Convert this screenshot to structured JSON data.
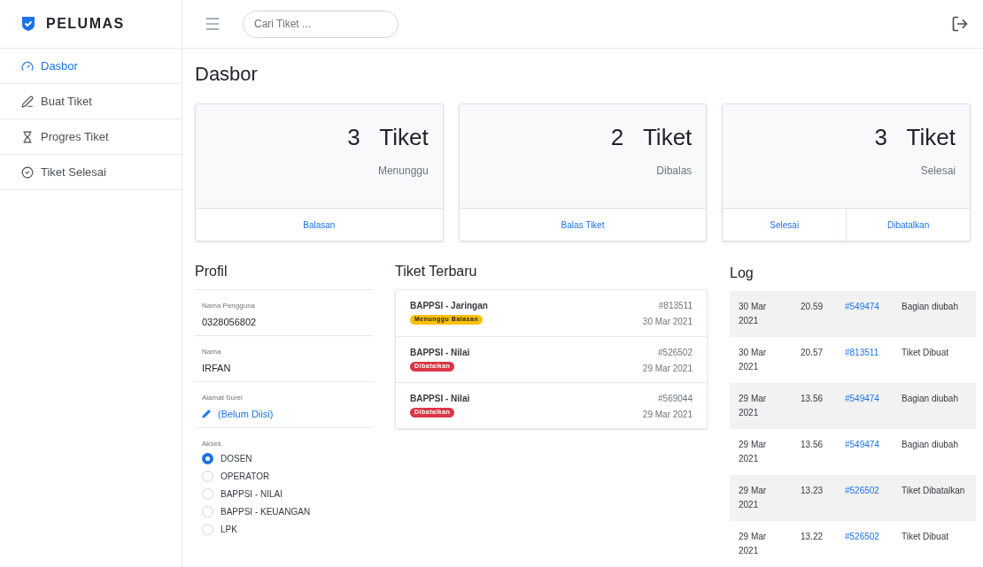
{
  "brand": "PELUMAS",
  "search": {
    "placeholder": "Cari Tiket ..."
  },
  "sidebar": {
    "items": [
      {
        "label": "Dasbor",
        "kind": "dashboard",
        "selected": true
      },
      {
        "label": "Buat Tiket",
        "kind": "create",
        "selected": false
      },
      {
        "label": "Progres Tiket",
        "kind": "progress",
        "selected": false
      },
      {
        "label": "Tiket Selesai",
        "kind": "done",
        "selected": false
      }
    ]
  },
  "page_title": "Dasbor",
  "stat_cards": [
    {
      "count": "3",
      "unit": "Tiket",
      "caption": "Menunggu",
      "actions": [
        "Balasan"
      ]
    },
    {
      "count": "2",
      "unit": "Tiket",
      "caption": "Dibalas",
      "actions": [
        "Balas Tiket"
      ]
    },
    {
      "count": "3",
      "unit": "Tiket",
      "caption": "Selesai",
      "actions": [
        "Selesai",
        "Dibatalkan"
      ]
    }
  ],
  "profile": {
    "title": "Profil",
    "fields": [
      {
        "label": "Nama Pengguna",
        "value": "0328056802",
        "kind": "text"
      },
      {
        "label": "Nama",
        "value": "IRFAN",
        "kind": "text"
      },
      {
        "label": "Alamat Surel",
        "value": "(Belum Diisi)",
        "kind": "edit"
      }
    ],
    "access": {
      "label": "Akses",
      "options": [
        {
          "label": "DOSEN",
          "selected": true
        },
        {
          "label": "OPERATOR",
          "selected": false
        },
        {
          "label": "BAPPSI - NILAI",
          "selected": false
        },
        {
          "label": "BAPPSI - KEUANGAN",
          "selected": false
        },
        {
          "label": "LPK",
          "selected": false
        }
      ]
    }
  },
  "recent_tickets": {
    "title": "Tiket Terbaru",
    "items": [
      {
        "title": "BAPPSI - Jaringan",
        "status": "Menunggu Balasan",
        "kind": "waiting",
        "number": "#813511",
        "date": "30 Mar 2021"
      },
      {
        "title": "BAPPSI - Nilai",
        "status": "Dibatalkan",
        "kind": "cancelled",
        "number": "#526502",
        "date": "29 Mar 2021"
      },
      {
        "title": "BAPPSI - Nilai",
        "status": "Dibatalkan",
        "kind": "cancelled",
        "number": "#569044",
        "date": "29 Mar 2021"
      }
    ]
  },
  "log": {
    "title": "Log",
    "rows": [
      {
        "date": "30 Mar 2021",
        "time": "20.59",
        "ticket": "#549474",
        "event": "Bagian diubah"
      },
      {
        "date": "30 Mar 2021",
        "time": "20.57",
        "ticket": "#813511",
        "event": "Tiket Dibuat"
      },
      {
        "date": "29 Mar 2021",
        "time": "13.56",
        "ticket": "#549474",
        "event": "Bagian diubah"
      },
      {
        "date": "29 Mar 2021",
        "time": "13.56",
        "ticket": "#549474",
        "event": "Bagian diubah"
      },
      {
        "date": "29 Mar 2021",
        "time": "13.23",
        "ticket": "#526502",
        "event": "Tiket Dibatalkan"
      },
      {
        "date": "29 Mar 2021",
        "time": "13.22",
        "ticket": "#526502",
        "event": "Tiket Dibuat"
      }
    ]
  }
}
